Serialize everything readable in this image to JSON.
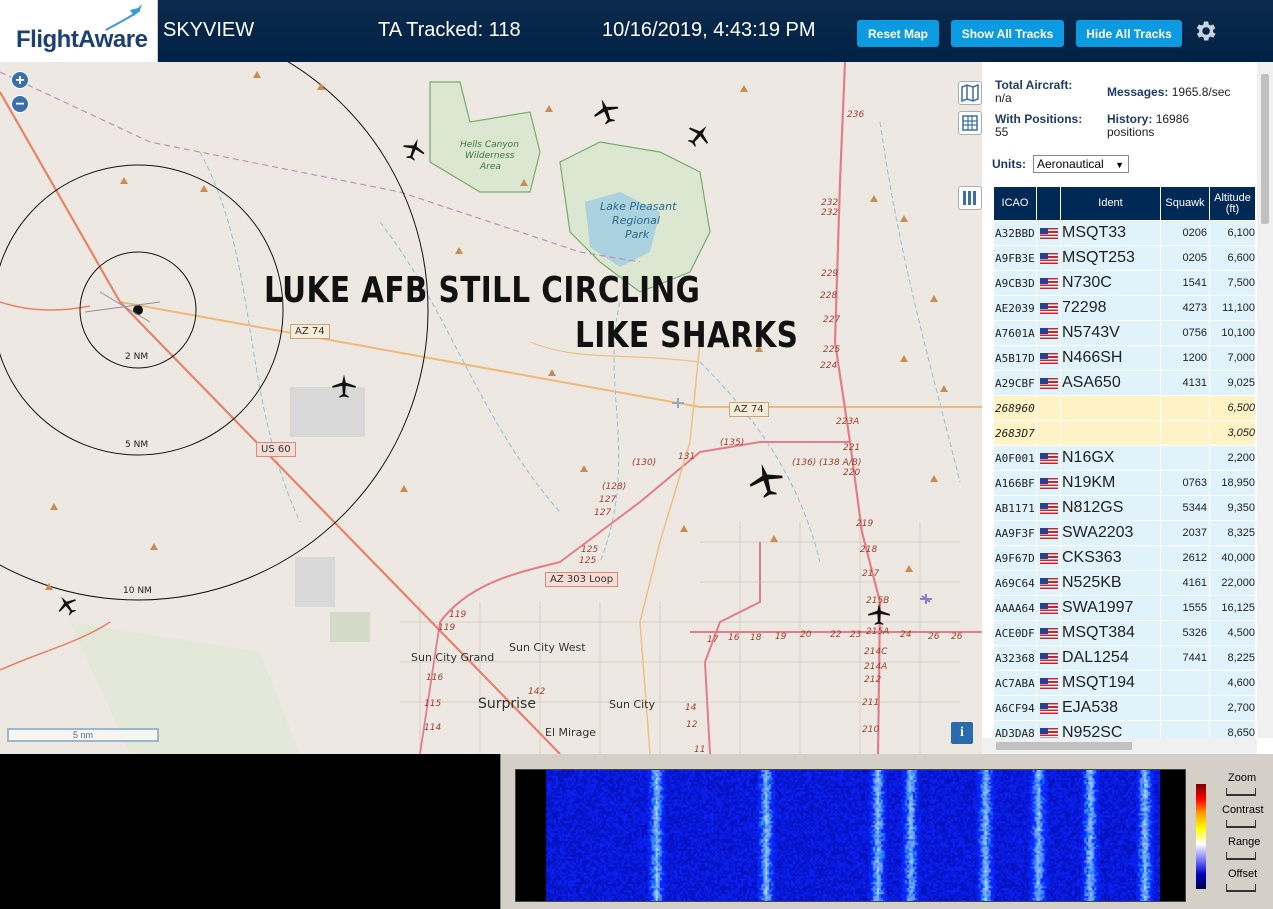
{
  "header": {
    "logo_text": "FlightAware",
    "app_title": "SKYVIEW",
    "tracked": "TA Tracked: 118",
    "datetime": "10/16/2019, 4:43:19 PM",
    "buttons": {
      "reset": "Reset Map",
      "show": "Show All Tracks",
      "hide": "Hide All Tracks"
    }
  },
  "map": {
    "overlay_line1": "LUKE AFB STILL CIRCLING",
    "overlay_line2": "LIKE SHARKS",
    "ring_labels": [
      "2 NM",
      "5 NM",
      "10 NM"
    ],
    "places": {
      "hells1": "Hells Canyon",
      "hells2": "Wilderness",
      "hells3": "Area",
      "lake1": "Lake Pleasant",
      "lake2": "Regional",
      "lake3": "Park",
      "sun_city_grand": "Sun City Grand",
      "sun_city_west": "Sun City West",
      "surprise": "Surprise",
      "sun_city": "Sun City",
      "el_mirage": "El Mirage"
    },
    "roads": {
      "az74a": "AZ 74",
      "az74b": "AZ 74",
      "us60": "US 60",
      "az303": "AZ 303 Loop"
    },
    "scale": "5 nm",
    "zoom_in": "+",
    "zoom_out": "−",
    "info": "i"
  },
  "panel": {
    "total_label": "Total Aircraft:",
    "total_value": "n/a",
    "messages_label": "Messages:",
    "messages_value": "1965.8/sec",
    "positions_label": "With Positions:",
    "positions_value": "55",
    "history_label": "History:",
    "history_value": "16986",
    "history_unit": "positions",
    "units_label": "Units:",
    "units_value": "Aeronautical",
    "columns": [
      "ICAO",
      "",
      "Ident",
      "Squawk",
      "Altitude (ft)"
    ],
    "rows": [
      {
        "icao": "A32BBD",
        "ident": "MSQT33",
        "squawk": "0206",
        "alt": "6,100",
        "flag": true
      },
      {
        "icao": "A9FB3E",
        "ident": "MSQT253",
        "squawk": "0205",
        "alt": "6,600",
        "flag": true
      },
      {
        "icao": "A9CB3D",
        "ident": "N730C",
        "squawk": "1541",
        "alt": "7,500",
        "flag": true
      },
      {
        "icao": "AE2039",
        "ident": "72298",
        "squawk": "4273",
        "alt": "11,100",
        "flag": true
      },
      {
        "icao": "A7601A",
        "ident": "N5743V",
        "squawk": "0756",
        "alt": "10,100",
        "flag": true
      },
      {
        "icao": "A5B17D",
        "ident": "N466SH",
        "squawk": "1200",
        "alt": "7,000",
        "flag": true
      },
      {
        "icao": "A29CBF",
        "ident": "ASA650",
        "squawk": "4131",
        "alt": "9,025",
        "flag": true
      },
      {
        "icao": "268960",
        "ident": "",
        "squawk": "",
        "alt": "6,500",
        "flag": false,
        "mlat": true
      },
      {
        "icao": "2683D7",
        "ident": "",
        "squawk": "",
        "alt": "3,050",
        "flag": false,
        "mlat": true
      },
      {
        "icao": "A0F001",
        "ident": "N16GX",
        "squawk": "",
        "alt": "2,200",
        "flag": true
      },
      {
        "icao": "A166BF",
        "ident": "N19KM",
        "squawk": "0763",
        "alt": "18,950",
        "flag": true
      },
      {
        "icao": "AB1171",
        "ident": "N812GS",
        "squawk": "5344",
        "alt": "9,350",
        "flag": true
      },
      {
        "icao": "AA9F3F",
        "ident": "SWA2203",
        "squawk": "2037",
        "alt": "8,325",
        "flag": true
      },
      {
        "icao": "A9F67D",
        "ident": "CKS363",
        "squawk": "2612",
        "alt": "40,000",
        "flag": true
      },
      {
        "icao": "A69C64",
        "ident": "N525KB",
        "squawk": "4161",
        "alt": "22,000",
        "flag": true
      },
      {
        "icao": "AAAA64",
        "ident": "SWA1997",
        "squawk": "1555",
        "alt": "16,125",
        "flag": true
      },
      {
        "icao": "ACE0DF",
        "ident": "MSQT384",
        "squawk": "5326",
        "alt": "4,500",
        "flag": true
      },
      {
        "icao": "A32368",
        "ident": "DAL1254",
        "squawk": "7441",
        "alt": "8,225",
        "flag": true
      },
      {
        "icao": "AC7ABA",
        "ident": "MSQT194",
        "squawk": "",
        "alt": "4,600",
        "flag": true
      },
      {
        "icao": "A6CF94",
        "ident": "EJA538",
        "squawk": "",
        "alt": "2,700",
        "flag": true
      },
      {
        "icao": "AD3DA8",
        "ident": "N952SC",
        "squawk": "",
        "alt": "8,650",
        "flag": true
      }
    ]
  },
  "waterfall": {
    "labels": [
      "Zoom",
      "Contrast",
      "Range",
      "Offset"
    ]
  }
}
